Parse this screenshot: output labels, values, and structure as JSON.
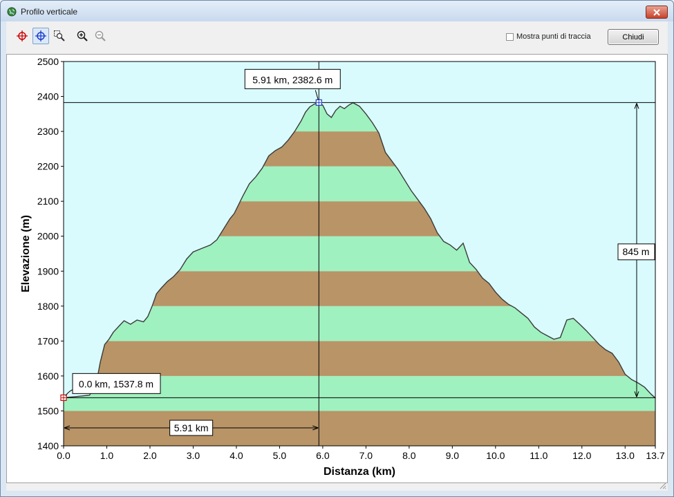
{
  "window": {
    "title": "Profilo verticale",
    "icon": "globe-icon"
  },
  "toolbar": {
    "tools": [
      {
        "name": "crosshair-icon",
        "active": false
      },
      {
        "name": "cursor-crosshair-icon",
        "active": true
      },
      {
        "name": "zoom-rect-icon",
        "active": false
      },
      {
        "name": "zoom-in-icon",
        "active": false
      },
      {
        "name": "zoom-out-icon",
        "active": false
      }
    ],
    "show_points_label": "Mostra punti di traccia",
    "show_points_checked": false,
    "close_label": "Chiudi"
  },
  "colors": {
    "sky": "#d9fbfe",
    "green_band": "#9ff1bf",
    "brown_band": "#b89467",
    "line": "#3a3a3a"
  },
  "chart_data": {
    "type": "area",
    "xlabel": "Distanza  (km)",
    "ylabel": "Elevazione (m)",
    "xlim": [
      0,
      13.7
    ],
    "ylim": [
      1400,
      2500
    ],
    "x_ticks": [
      0,
      1,
      2,
      3,
      4,
      5,
      6,
      7,
      8,
      9,
      10,
      11,
      12,
      13,
      13.7
    ],
    "x_tick_labels": [
      "0.0",
      "1.0",
      "2.0",
      "3.0",
      "4.0",
      "5.0",
      "6.0",
      "7.0",
      "8.0",
      "9.0",
      "10.0",
      "11.0",
      "12.0",
      "13.0",
      "13.7"
    ],
    "y_ticks": [
      1400,
      1500,
      1600,
      1700,
      1800,
      1900,
      2000,
      2100,
      2200,
      2300,
      2400,
      2500
    ],
    "y_tick_labels": [
      "1400",
      "1500",
      "1600",
      "1700",
      "1800",
      "1900",
      "2000",
      "2100",
      "2200",
      "2300",
      "2400",
      "2500"
    ],
    "grid": false,
    "band_step": 100,
    "profile": {
      "x": [
        0,
        0.3,
        0.6,
        0.75,
        0.85,
        0.95,
        1.05,
        1.15,
        1.3,
        1.4,
        1.55,
        1.7,
        1.85,
        1.95,
        2.05,
        2.15,
        2.25,
        2.4,
        2.55,
        2.7,
        2.85,
        3.0,
        3.2,
        3.4,
        3.55,
        3.7,
        3.85,
        3.95,
        4.05,
        4.15,
        4.3,
        4.45,
        4.6,
        4.75,
        4.9,
        5.05,
        5.2,
        5.35,
        5.5,
        5.6,
        5.7,
        5.8,
        5.91,
        6.0,
        6.1,
        6.2,
        6.3,
        6.4,
        6.5,
        6.6,
        6.7,
        6.85,
        7.0,
        7.15,
        7.3,
        7.45,
        7.6,
        7.75,
        7.9,
        8.05,
        8.2,
        8.35,
        8.5,
        8.65,
        8.8,
        8.95,
        9.1,
        9.25,
        9.4,
        9.55,
        9.7,
        9.85,
        10.0,
        10.15,
        10.3,
        10.45,
        10.6,
        10.75,
        10.9,
        11.05,
        11.2,
        11.35,
        11.5,
        11.65,
        11.8,
        11.95,
        12.1,
        12.25,
        12.4,
        12.55,
        12.7,
        12.85,
        13.0,
        13.15,
        13.3,
        13.45,
        13.6,
        13.7
      ],
      "y": [
        1537.8,
        1541,
        1545,
        1575,
        1640,
        1690,
        1705,
        1725,
        1745,
        1758,
        1748,
        1760,
        1755,
        1770,
        1800,
        1835,
        1850,
        1870,
        1885,
        1905,
        1935,
        1955,
        1965,
        1975,
        1990,
        2020,
        2050,
        2065,
        2090,
        2115,
        2150,
        2170,
        2195,
        2230,
        2245,
        2255,
        2275,
        2300,
        2330,
        2355,
        2370,
        2378,
        2382.6,
        2375,
        2350,
        2340,
        2360,
        2372,
        2365,
        2375,
        2382,
        2372,
        2350,
        2325,
        2295,
        2240,
        2215,
        2190,
        2160,
        2130,
        2105,
        2080,
        2050,
        2010,
        1985,
        1975,
        1960,
        1980,
        1925,
        1905,
        1880,
        1865,
        1840,
        1820,
        1805,
        1795,
        1780,
        1765,
        1740,
        1725,
        1715,
        1705,
        1710,
        1760,
        1765,
        1748,
        1730,
        1710,
        1690,
        1675,
        1665,
        1640,
        1605,
        1590,
        1580,
        1568,
        1548,
        1537
      ]
    },
    "markers": [
      {
        "x": 0.0,
        "y": 1537.8,
        "label": "0.0 km, 1537.8 m"
      },
      {
        "x": 5.91,
        "y": 2382.6,
        "label": "5.91 km, 2382.6 m"
      }
    ],
    "distance_label": "5.91 km",
    "elevation_gain_label": "845 m"
  }
}
